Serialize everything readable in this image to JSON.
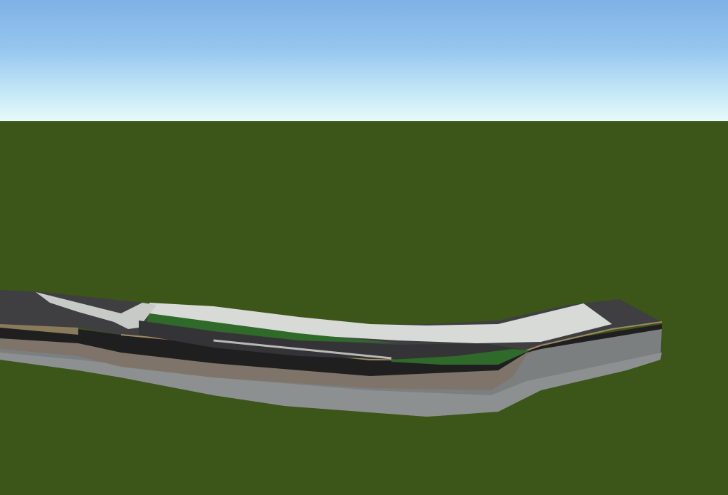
{
  "scene": {
    "type": "3d-terrain-viewport",
    "colors": {
      "sky_top": "#7fb1e6",
      "sky_horizon": "#e8fbfb",
      "ground": "#3c5518",
      "asphalt": "#3f3f42",
      "asphalt_edge": "#2a2a2c",
      "concrete": "#d8dad8",
      "grass_strip": "#2f6a2a",
      "soil_layer": "#7e7469",
      "clay_layer": "#8a7a5c",
      "dark_layer": "#1e1e1e",
      "bedrock_layer": "#7c7f80",
      "curb": "#a08a60"
    },
    "layers": [
      "asphalt",
      "concrete",
      "grass_strip",
      "soil_layer",
      "dark_layer",
      "bedrock_layer"
    ]
  }
}
